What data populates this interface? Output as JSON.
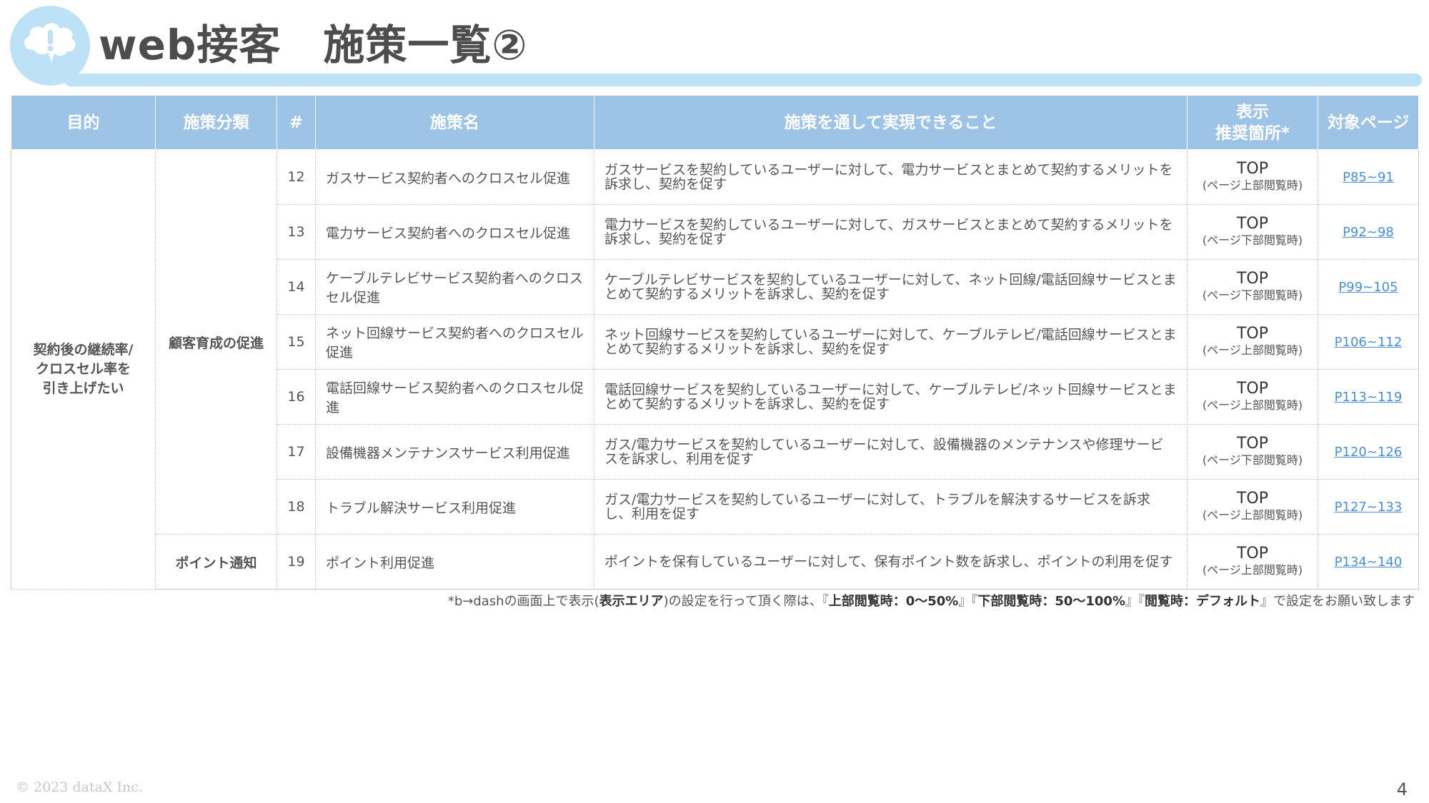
{
  "title": "web接客　施策一覧②",
  "logo_icon": "speech-bubble-exclamation-icon",
  "accent_color": "#9dc3e6",
  "table": {
    "headers": {
      "purpose": "目的",
      "category": "施策分類",
      "number": "#",
      "name": "施策名",
      "description": "施策を通して実現できること",
      "location_line1": "表示",
      "location_line2": "推奨箇所*",
      "pages": "対象ページ"
    },
    "purpose": {
      "line1": "契約後の継続率/",
      "line2": "クロスセル率を",
      "line3": "引き上げたい"
    },
    "categories": [
      "顧客育成の促進",
      "ポイント通知"
    ],
    "rows": [
      {
        "number": "12",
        "name": "ガスサービス契約者へのクロスセル促進",
        "description": "ガスサービスを契約しているユーザーに対して、電力サービスとまとめて契約するメリットを訴求し、契約を促す",
        "location": "TOP",
        "location_note": "(ページ上部閲覧時)",
        "pages": "P85~91"
      },
      {
        "number": "13",
        "name": "電力サービス契約者へのクロスセル促進",
        "description": "電力サービスを契約しているユーザーに対して、ガスサービスとまとめて契約するメリットを訴求し、契約を促す",
        "location": "TOP",
        "location_note": "(ページ下部閲覧時)",
        "pages": "P92~98"
      },
      {
        "number": "14",
        "name": "ケーブルテレビサービス契約者へのクロスセル促進",
        "description": "ケーブルテレビサービスを契約しているユーザーに対して、ネット回線/電話回線サービスとまとめて契約するメリットを訴求し、契約を促す",
        "location": "TOP",
        "location_note": "(ページ下部閲覧時)",
        "pages": "P99~105"
      },
      {
        "number": "15",
        "name": "ネット回線サービス契約者へのクロスセル促進",
        "description": "ネット回線サービスを契約しているユーザーに対して、ケーブルテレビ/電話回線サービスとまとめて契約するメリットを訴求し、契約を促す",
        "location": "TOP",
        "location_note": "(ページ上部閲覧時)",
        "pages": "P106~112"
      },
      {
        "number": "16",
        "name": "電話回線サービス契約者へのクロスセル促進",
        "description": "電話回線サービスを契約しているユーザーに対して、ケーブルテレビ/ネット回線サービスとまとめて契約するメリットを訴求し、契約を促す",
        "location": "TOP",
        "location_note": "(ページ上部閲覧時)",
        "pages": "P113~119"
      },
      {
        "number": "17",
        "name": "設備機器メンテナンスサービス利用促進",
        "description": "ガス/電力サービスを契約しているユーザーに対して、設備機器のメンテナンスや修理サービスを訴求し、利用を促す",
        "location": "TOP",
        "location_note": "(ページ下部閲覧時)",
        "pages": "P120~126"
      },
      {
        "number": "18",
        "name": "トラブル解決サービス利用促進",
        "description": "ガス/電力サービスを契約しているユーザーに対して、トラブルを解決するサービスを訴求し、利用を促す",
        "location": "TOP",
        "location_note": "(ページ上部閲覧時)",
        "pages": "P127~133"
      },
      {
        "number": "19",
        "name": "ポイント利用促進",
        "description": "ポイントを保有しているユーザーに対して、保有ポイント数を訴求し、ポイントの利用を促す",
        "location": "TOP",
        "location_note": "(ページ上部閲覧時)",
        "pages": "P134~140"
      }
    ]
  },
  "footnote": {
    "part1": "*b→dashの画面上で表示(",
    "bold1": "表示エリア",
    "part2": ")の設定を行って頂く際は、『",
    "bold2": "上部閲覧時：0〜50%",
    "part3": "』『",
    "bold3": "下部閲覧時：50〜100%",
    "part4": "』『",
    "bold4": "閲覧時：デフォルト",
    "part5": "』で設定をお願い致します"
  },
  "copyright": "© 2023 dataX Inc.",
  "page_number": "4"
}
